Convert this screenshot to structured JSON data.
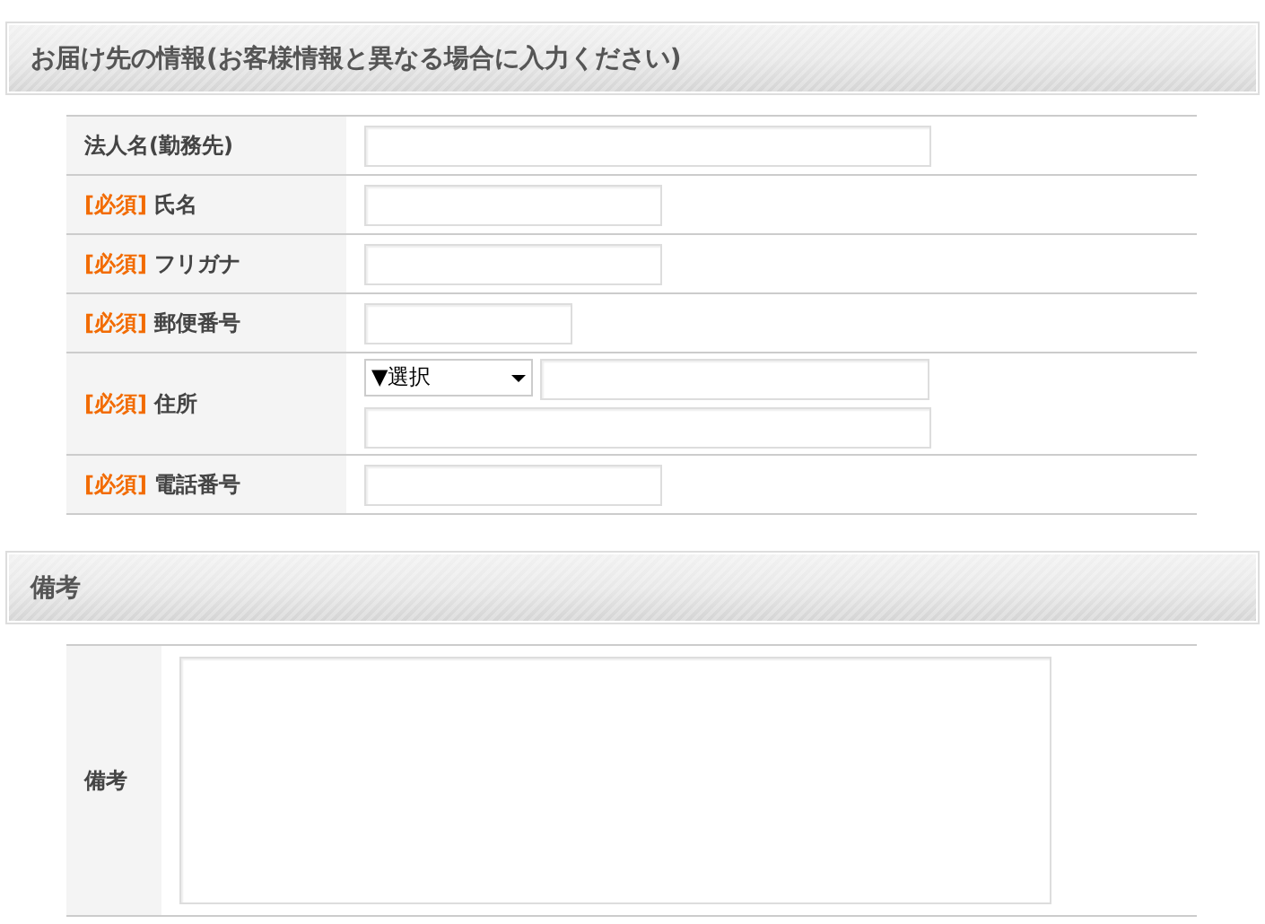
{
  "sections": [
    {
      "heading": "お届け先の情報(お客様情報と異なる場合に入力ください)",
      "rows": [
        {
          "label": "法人名(勤務先)",
          "fields": [
            {
              "kind": "wide"
            }
          ]
        },
        {
          "required_mark": "[必須]",
          "label": "氏名",
          "fields": [
            {
              "kind": "medium"
            }
          ]
        },
        {
          "required_mark": "[必須]",
          "label": "フリガナ",
          "fields": [
            {
              "kind": "medium"
            }
          ]
        },
        {
          "required_mark": "[必須]",
          "label": "郵便番号",
          "fields": [
            {
              "kind": "short"
            }
          ]
        },
        {
          "required_mark": "[必須]",
          "label": "住所",
          "fields": [
            {
              "kind": "select",
              "value": "▼選択"
            },
            {
              "kind": "address"
            },
            {
              "kind": "wide"
            }
          ]
        },
        {
          "required_mark": "[必須]",
          "label": "電話番号",
          "fields": [
            {
              "kind": "medium"
            }
          ]
        }
      ]
    },
    {
      "heading": "備考",
      "rows": [
        {
          "label": "備考",
          "fields": [
            {
              "kind": "textarea"
            }
          ]
        }
      ]
    }
  ]
}
